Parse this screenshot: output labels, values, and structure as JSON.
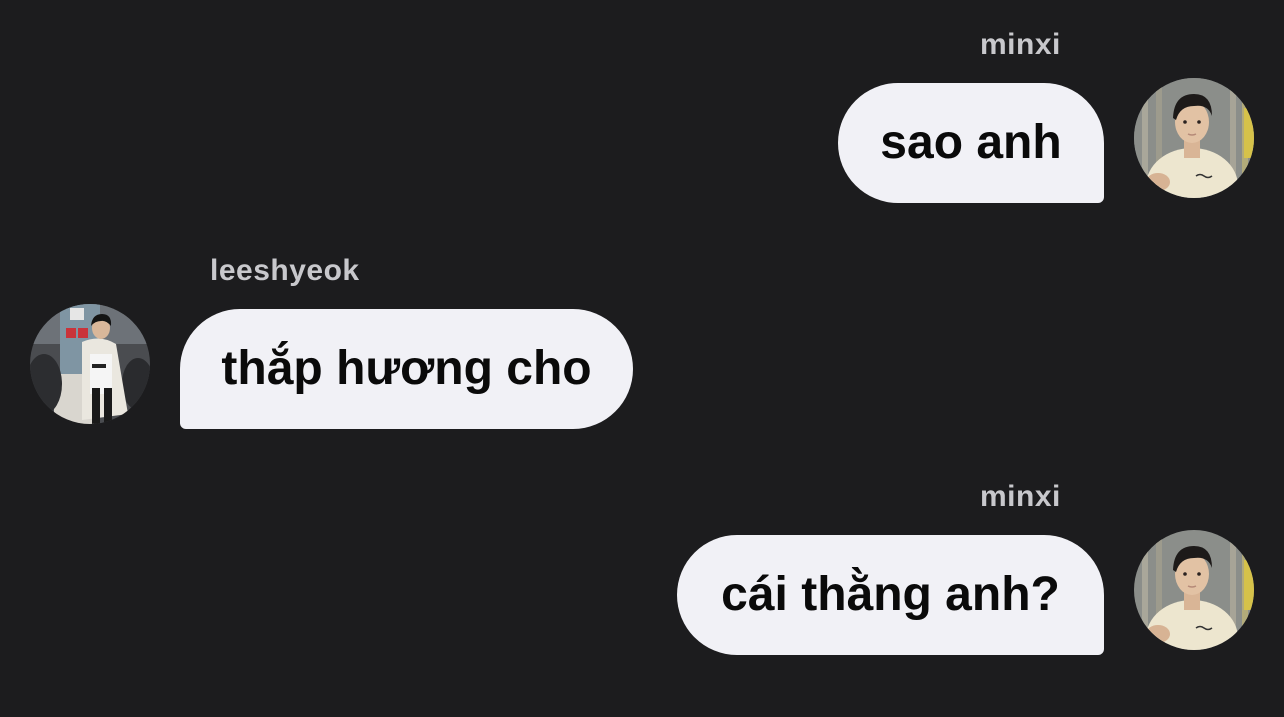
{
  "messages": [
    {
      "sender": "minxi",
      "text": "sao anh",
      "direction": "outgoing",
      "avatar_icon": "minxi-avatar-icon"
    },
    {
      "sender": "leeshyeok",
      "text": "thắp hương cho",
      "direction": "incoming",
      "avatar_icon": "leeshyeok-avatar-icon"
    },
    {
      "sender": "minxi",
      "text": "cái thằng anh?",
      "direction": "outgoing",
      "avatar_icon": "minxi-avatar-icon"
    }
  ],
  "colors": {
    "background": "#1c1c1e",
    "bubble": "#f1f1f6",
    "bubble_text": "#0a0a0a",
    "sender_text": "#c8c8cc"
  }
}
